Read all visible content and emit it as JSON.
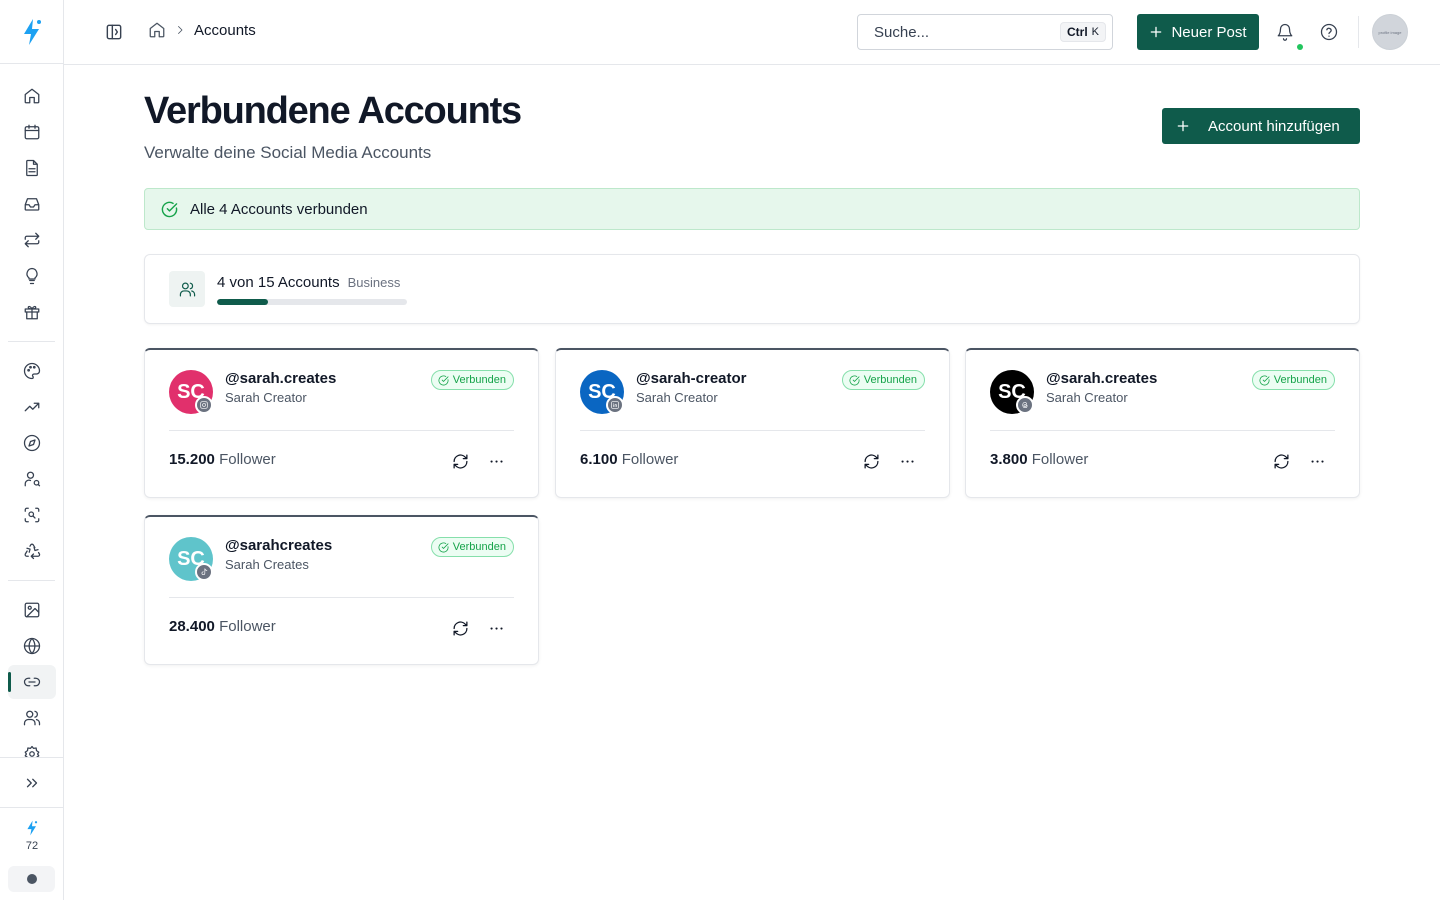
{
  "header": {
    "breadcrumb": "Accounts",
    "search_placeholder": "Suche...",
    "search_shortcut_ctrl": "Ctrl",
    "search_shortcut_key": "K",
    "new_post_label": "Neuer Post",
    "avatar_text": "profile image"
  },
  "sidebar": {
    "credits": "72",
    "active_item": "link"
  },
  "page": {
    "title": "Verbundene Accounts",
    "subtitle": "Verwalte deine Social Media Accounts",
    "add_account_label": "Account hinzufügen"
  },
  "banner": {
    "text": "Alle 4 Accounts verbunden"
  },
  "usage": {
    "text": "4 von 15 Accounts",
    "plan": "Business",
    "used": 4,
    "limit": 15
  },
  "accounts": [
    {
      "handle": "@sarah.creates",
      "name": "Sarah Creator",
      "initials": "SC",
      "platform": "instagram",
      "color": "#e1306c",
      "status": "Verbunden",
      "followers": "15.200",
      "followers_label": "Follower"
    },
    {
      "handle": "@sarah-creator",
      "name": "Sarah Creator",
      "initials": "SC",
      "platform": "linkedin",
      "color": "#0a66c2",
      "status": "Verbunden",
      "followers": "6.100",
      "followers_label": "Follower"
    },
    {
      "handle": "@sarah.creates",
      "name": "Sarah Creator",
      "initials": "SC",
      "platform": "threads",
      "color": "#000000",
      "status": "Verbunden",
      "followers": "3.800",
      "followers_label": "Follower"
    },
    {
      "handle": "@sarahcreates",
      "name": "Sarah Creates",
      "initials": "SC",
      "platform": "tiktok",
      "color": "#5fc4cb",
      "status": "Verbunden",
      "followers": "28.400",
      "followers_label": "Follower"
    }
  ],
  "colors": {
    "brand": "#0f5b4b",
    "success": "#16a34a"
  }
}
